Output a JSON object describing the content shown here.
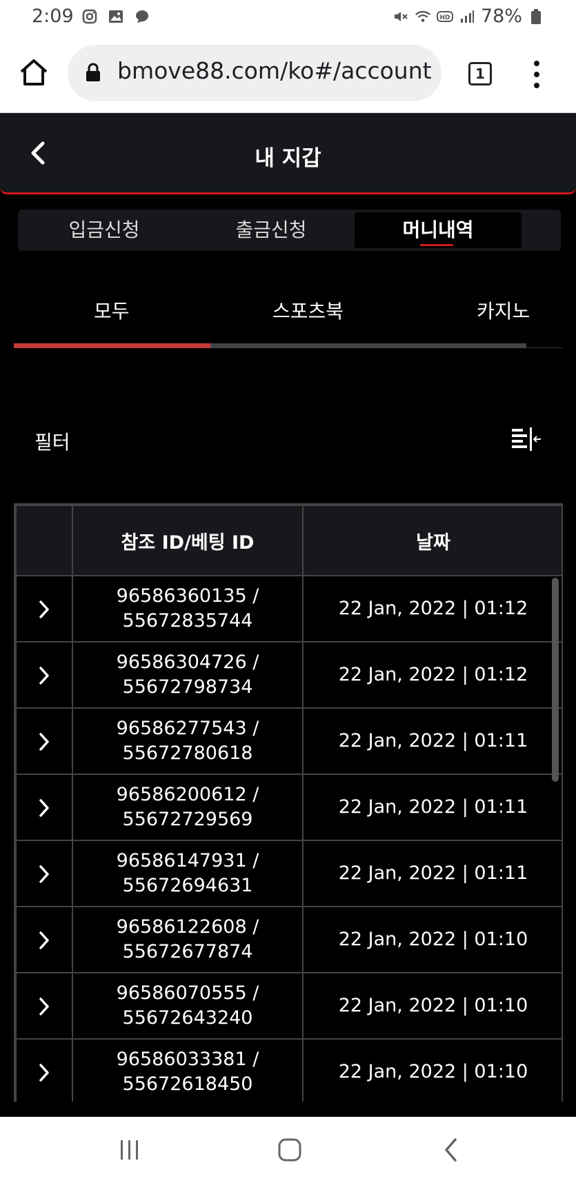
{
  "status_bar": {
    "time": "2:09",
    "battery": "78%",
    "left_icons": [
      "instagram-icon",
      "gallery-icon",
      "chat-bubble-icon"
    ],
    "right_icons": [
      "mute-icon",
      "wifi-icon",
      "hd-icon",
      "signal-icon",
      "battery-icon"
    ]
  },
  "browser": {
    "url": "bmove88.com/ko#/account/",
    "tab_count": "1"
  },
  "header": {
    "title": "내 지갑"
  },
  "top_tabs": [
    {
      "label": "입금신청",
      "active": false
    },
    {
      "label": "출금신청",
      "active": false
    },
    {
      "label": "머니내역",
      "active": true
    }
  ],
  "sub_tabs": [
    {
      "label": "모두",
      "active": true
    },
    {
      "label": "스포츠북",
      "active": false
    },
    {
      "label": "카지노",
      "active": false
    }
  ],
  "filter": {
    "label": "필터"
  },
  "table": {
    "headers": [
      "",
      "참조 ID/베팅 ID",
      "날짜"
    ],
    "rows": [
      {
        "ref_id": "96586360135 /",
        "bet_id": "55672835744",
        "date": "22 Jan, 2022 | 01:12"
      },
      {
        "ref_id": "96586304726 /",
        "bet_id": "55672798734",
        "date": "22 Jan, 2022 | 01:12"
      },
      {
        "ref_id": "96586277543 /",
        "bet_id": "55672780618",
        "date": "22 Jan, 2022 | 01:11"
      },
      {
        "ref_id": "96586200612 /",
        "bet_id": "55672729569",
        "date": "22 Jan, 2022 | 01:11"
      },
      {
        "ref_id": "96586147931 /",
        "bet_id": "55672694631",
        "date": "22 Jan, 2022 | 01:11"
      },
      {
        "ref_id": "96586122608 /",
        "bet_id": "55672677874",
        "date": "22 Jan, 2022 | 01:10"
      },
      {
        "ref_id": "96586070555 /",
        "bet_id": "55672643240",
        "date": "22 Jan, 2022 | 01:10"
      },
      {
        "ref_id": "96586033381 /",
        "bet_id": "55672618450",
        "date": "22 Jan, 2022 | 01:10"
      }
    ]
  },
  "colors": {
    "accent": "#d11a1a",
    "header_bg": "#17181c",
    "page_bg": "#000000"
  }
}
